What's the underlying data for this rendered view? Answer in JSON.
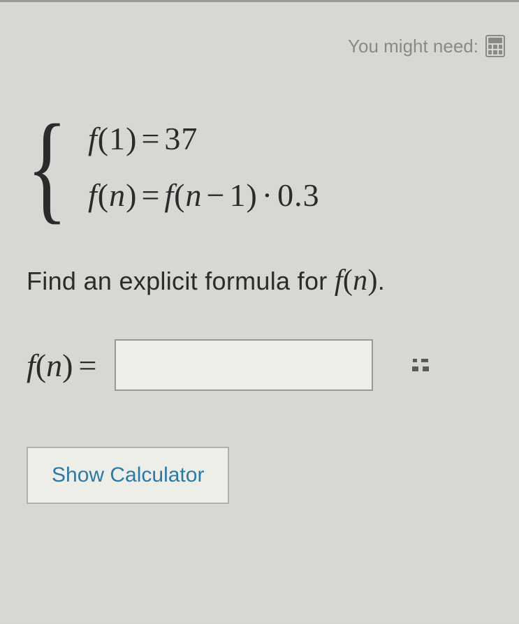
{
  "hint": {
    "label": "You might need:"
  },
  "problem": {
    "equation1": "f(1) = 37",
    "equation2": "f(n) = f(n − 1) · 0.3",
    "prompt_prefix": "Find an explicit formula for ",
    "prompt_var": "f(n)",
    "prompt_suffix": "."
  },
  "answer": {
    "label": "f(n) =",
    "value": "",
    "placeholder": ""
  },
  "buttons": {
    "show_calculator": "Show Calculator"
  }
}
